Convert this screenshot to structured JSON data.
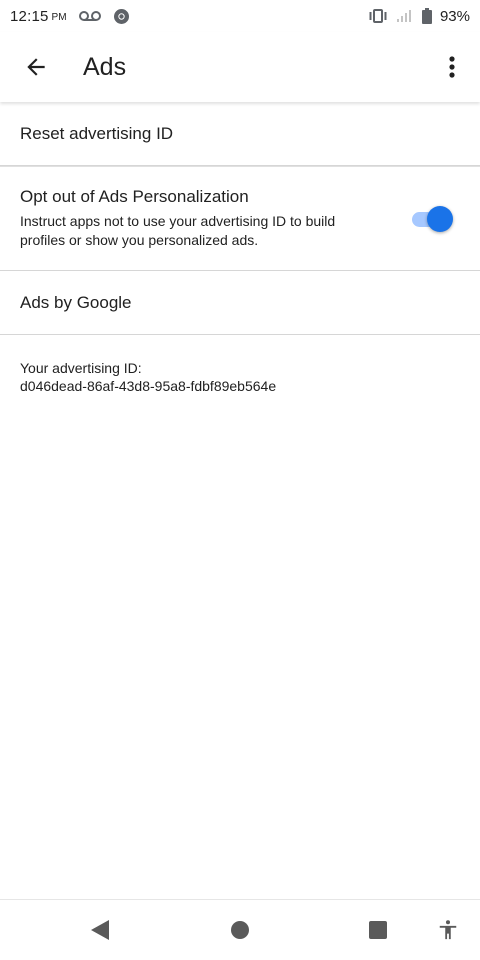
{
  "status_bar": {
    "time": "12:15",
    "ampm": "PM",
    "battery": "93%",
    "icons": [
      "voicemail-icon",
      "chrome-icon",
      "vibrate-icon",
      "signal-icon",
      "battery-icon"
    ]
  },
  "app_bar": {
    "title": "Ads",
    "back_icon": "arrow-back-icon",
    "menu_icon": "more-vert-icon"
  },
  "items": {
    "reset": "Reset advertising ID",
    "optout": {
      "title": "Opt out of Ads Personalization",
      "description": "Instruct apps not to use your advertising ID to build profiles or show you personalized ads.",
      "toggle_on": true
    },
    "ads_by_google": "Ads by Google"
  },
  "advertising_id": {
    "label": "Your advertising ID:",
    "value": "d046dead-86af-43d8-95a8-fdbf89eb564e"
  },
  "nav_bar": {
    "icons": [
      "back-triangle-icon",
      "home-circle-icon",
      "recents-square-icon",
      "accessibility-icon"
    ]
  },
  "colors": {
    "accent": "#1a73e8",
    "toggle_track": "#a6c8ff",
    "text": "#212121",
    "divider": "#d6d6d6"
  }
}
